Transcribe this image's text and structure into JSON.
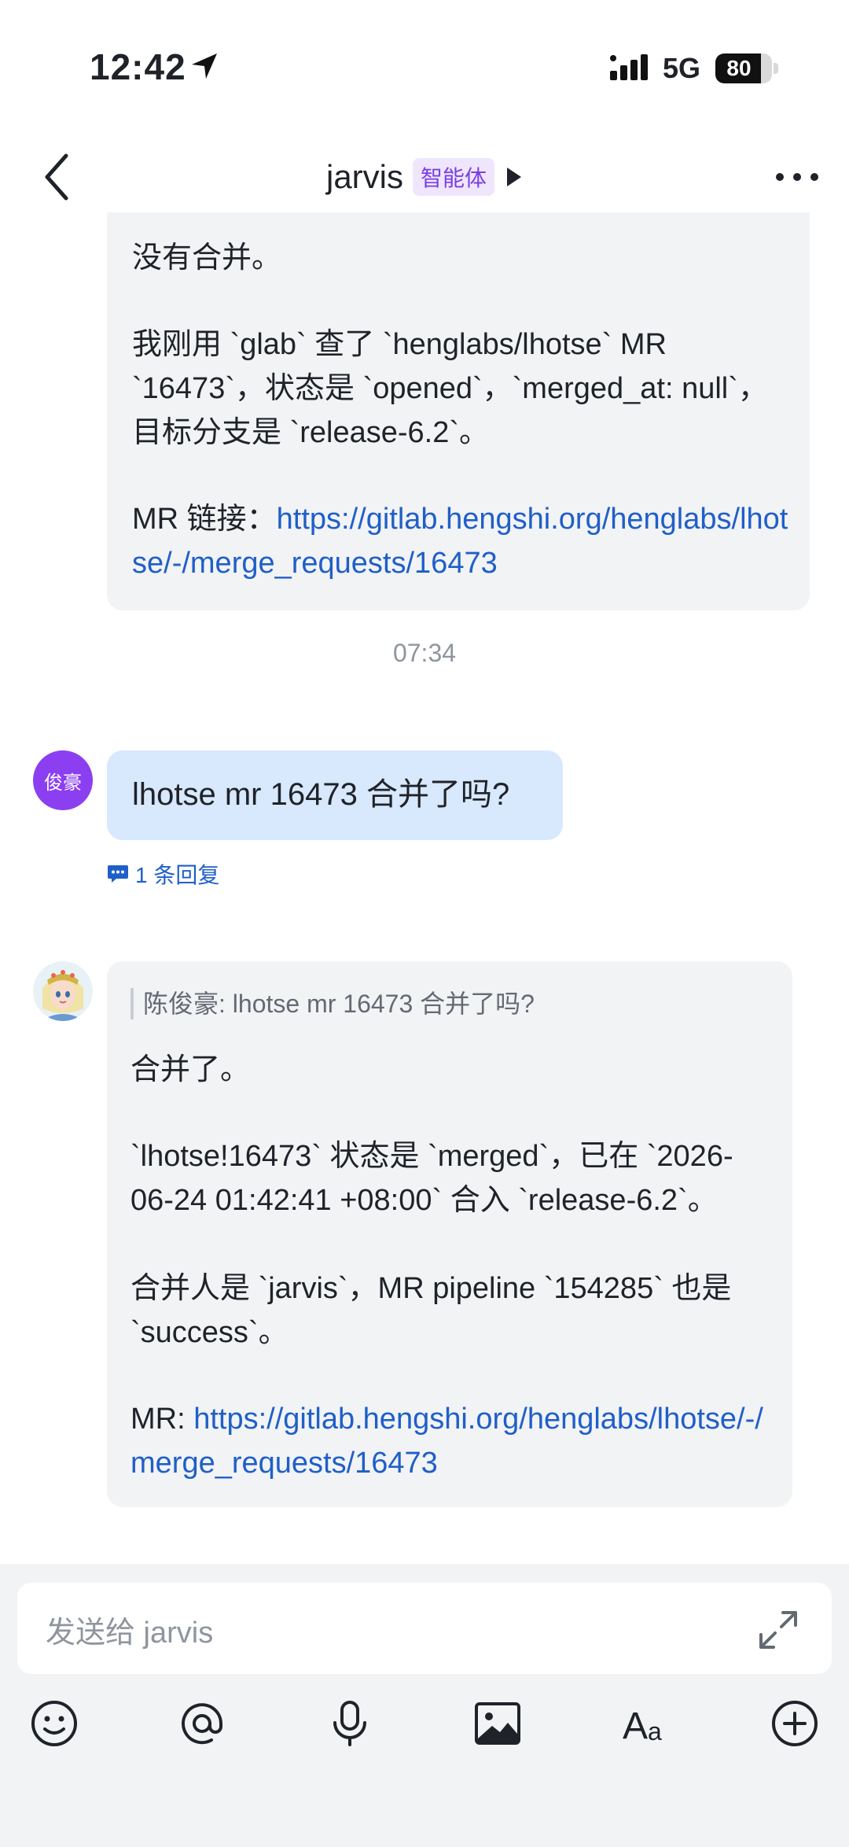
{
  "status_bar": {
    "time": "12:42",
    "network": "5G",
    "battery_level": 80,
    "battery_text": "80"
  },
  "header": {
    "title": "jarvis",
    "badge": "智能体"
  },
  "messages": {
    "first": {
      "p1": "没有合并。",
      "p2": "我刚用 `glab` 查了 `henglabs/lhotse` MR `16473`，状态是 `opened`，`merged_at: null`，目标分支是 `release-6.2`。",
      "p3_label": "MR 链接：",
      "p3_link": "https://gitlab.hengshi.org/henglabs/lhotse/-/merge_requests/16473"
    },
    "timestamp": "07:34",
    "user": {
      "avatar_label": "俊豪",
      "text": "lhotse mr 16473 合并了吗?",
      "reply_count": "1 条回复"
    },
    "bot": {
      "quote": "陈俊豪: lhotse mr 16473 合并了吗?",
      "p1": "合并了。",
      "p2": "`lhotse!16473` 状态是 `merged`，已在 `2026-06-24 01:42:41 +08:00` 合入 `release-6.2`。",
      "p3": "合并人是 `jarvis`，MR pipeline `154285` 也是 `success`。",
      "p4_label": "MR: ",
      "p4_link": "https://gitlab.hengshi.org/henglabs/lhotse/-/merge_requests/16473"
    }
  },
  "composer": {
    "placeholder": "发送给 jarvis"
  },
  "icons": {
    "back": "back-chevron-icon",
    "more": "more-dots-icon",
    "emoji": "emoji-icon",
    "mention": "at-icon",
    "voice": "microphone-icon",
    "image": "image-icon",
    "format": "text-format-icon",
    "add": "plus-icon",
    "expand": "expand-icon"
  },
  "colors": {
    "accent_link": "#1f5fc8",
    "user_bubble": "#d8e8fd",
    "bot_bubble": "#f2f3f5",
    "badge_bg": "#efe6fd",
    "badge_text": "#7a3fe4",
    "user_avatar": "#8b3ff0"
  }
}
